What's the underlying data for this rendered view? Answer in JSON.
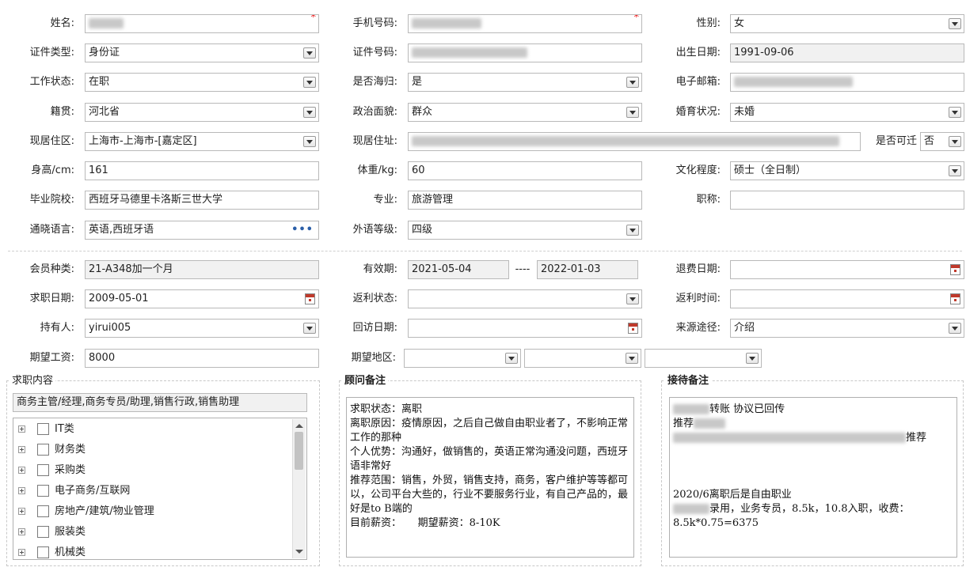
{
  "form": {
    "name_label": "姓名:",
    "phone_label": "手机号码:",
    "gender_label": "性别:",
    "gender_value": "女",
    "id_type_label": "证件类型:",
    "id_type_value": "身份证",
    "id_no_label": "证件号码:",
    "birth_label": "出生日期:",
    "birth_value": "1991-09-06",
    "work_status_label": "工作状态:",
    "work_status_value": "在职",
    "returnee_label": "是否海归:",
    "returnee_value": "是",
    "email_label": "电子邮箱:",
    "native_label": "籍贯:",
    "native_value": "河北省",
    "political_label": "政治面貌:",
    "political_value": "群众",
    "marital_label": "婚育状况:",
    "marital_value": "未婚",
    "residence_label": "现居住区:",
    "residence_value": "上海市-上海市-[嘉定区]",
    "address_label": "现居住址:",
    "relocate_label": "是否可迁",
    "relocate_value": "否",
    "height_label": "身高/cm:",
    "height_value": "161",
    "weight_label": "体重/kg:",
    "weight_value": "60",
    "education_label": "文化程度:",
    "education_value": "硕士（全日制）",
    "school_label": "毕业院校:",
    "school_value": "西班牙马德里卡洛斯三世大学",
    "major_label": "专业:",
    "major_value": "旅游管理",
    "title_label": "职称:",
    "title_value": "",
    "language_label": "通晓语言:",
    "language_value": "英语,西班牙语",
    "language_more": "•••",
    "lang_level_label": "外语等级:",
    "lang_level_value": "四级"
  },
  "membership": {
    "type_label": "会员种类:",
    "type_value": "21-A348加一个月",
    "valid_label": "有效期:",
    "valid_from": "2021-05-04",
    "valid_sep": "----",
    "valid_to": "2022-01-03",
    "refund_label": "退费日期:",
    "refund_value": "",
    "jobdate_label": "求职日期:",
    "jobdate_value": "2009-05-01",
    "rebate_status_label": "返利状态:",
    "rebate_status_value": "",
    "rebate_time_label": "返利时间:",
    "rebate_time_value": "",
    "holder_label": "持有人:",
    "holder_value": "yirui005",
    "visit_label": "回访日期:",
    "visit_value": "",
    "source_label": "来源途径:",
    "source_value": "介绍",
    "salary_label": "期望工资:",
    "salary_value": "8000",
    "region_label": "期望地区:",
    "region1": "",
    "region2": "",
    "region3": ""
  },
  "job_content": {
    "legend": "求职内容",
    "selected": "商务主管/经理,商务专员/助理,销售行政,销售助理",
    "tree": [
      "IT类",
      "财务类",
      "采购类",
      "电子商务/互联网",
      "房地产/建筑/物业管理",
      "服装类",
      "机械类"
    ]
  },
  "advisor_note": {
    "legend": "顾问备注",
    "text": "求职状态：离职\n离职原因：疫情原因，之后自己做自由职业者了，不影响正常工作的那种\n个人优势：沟通好，做销售的，英语正常沟通没问题，西班牙语非常好\n推荐范围：销售，外贸，销售支持，商务，客户维护等等都可以，公司平台大些的，行业不要服务行业，有自己产品的，最好是to B端的\n目前薪资：     期望薪资：8-10K"
  },
  "reception_note": {
    "legend": "接待备注",
    "line1": "转账 协议已回传",
    "line2": "推荐",
    "line3": "推荐",
    "line4": "2020/6离职后是自由职业",
    "line5": "录用，业务专员，8.5k，10.8入职，收费：",
    "line6": "8.5k*0.75=6375"
  },
  "colors": {
    "required": "#e00000",
    "readonly_bg": "#f1f1f1",
    "border": "#b9b9b9"
  }
}
